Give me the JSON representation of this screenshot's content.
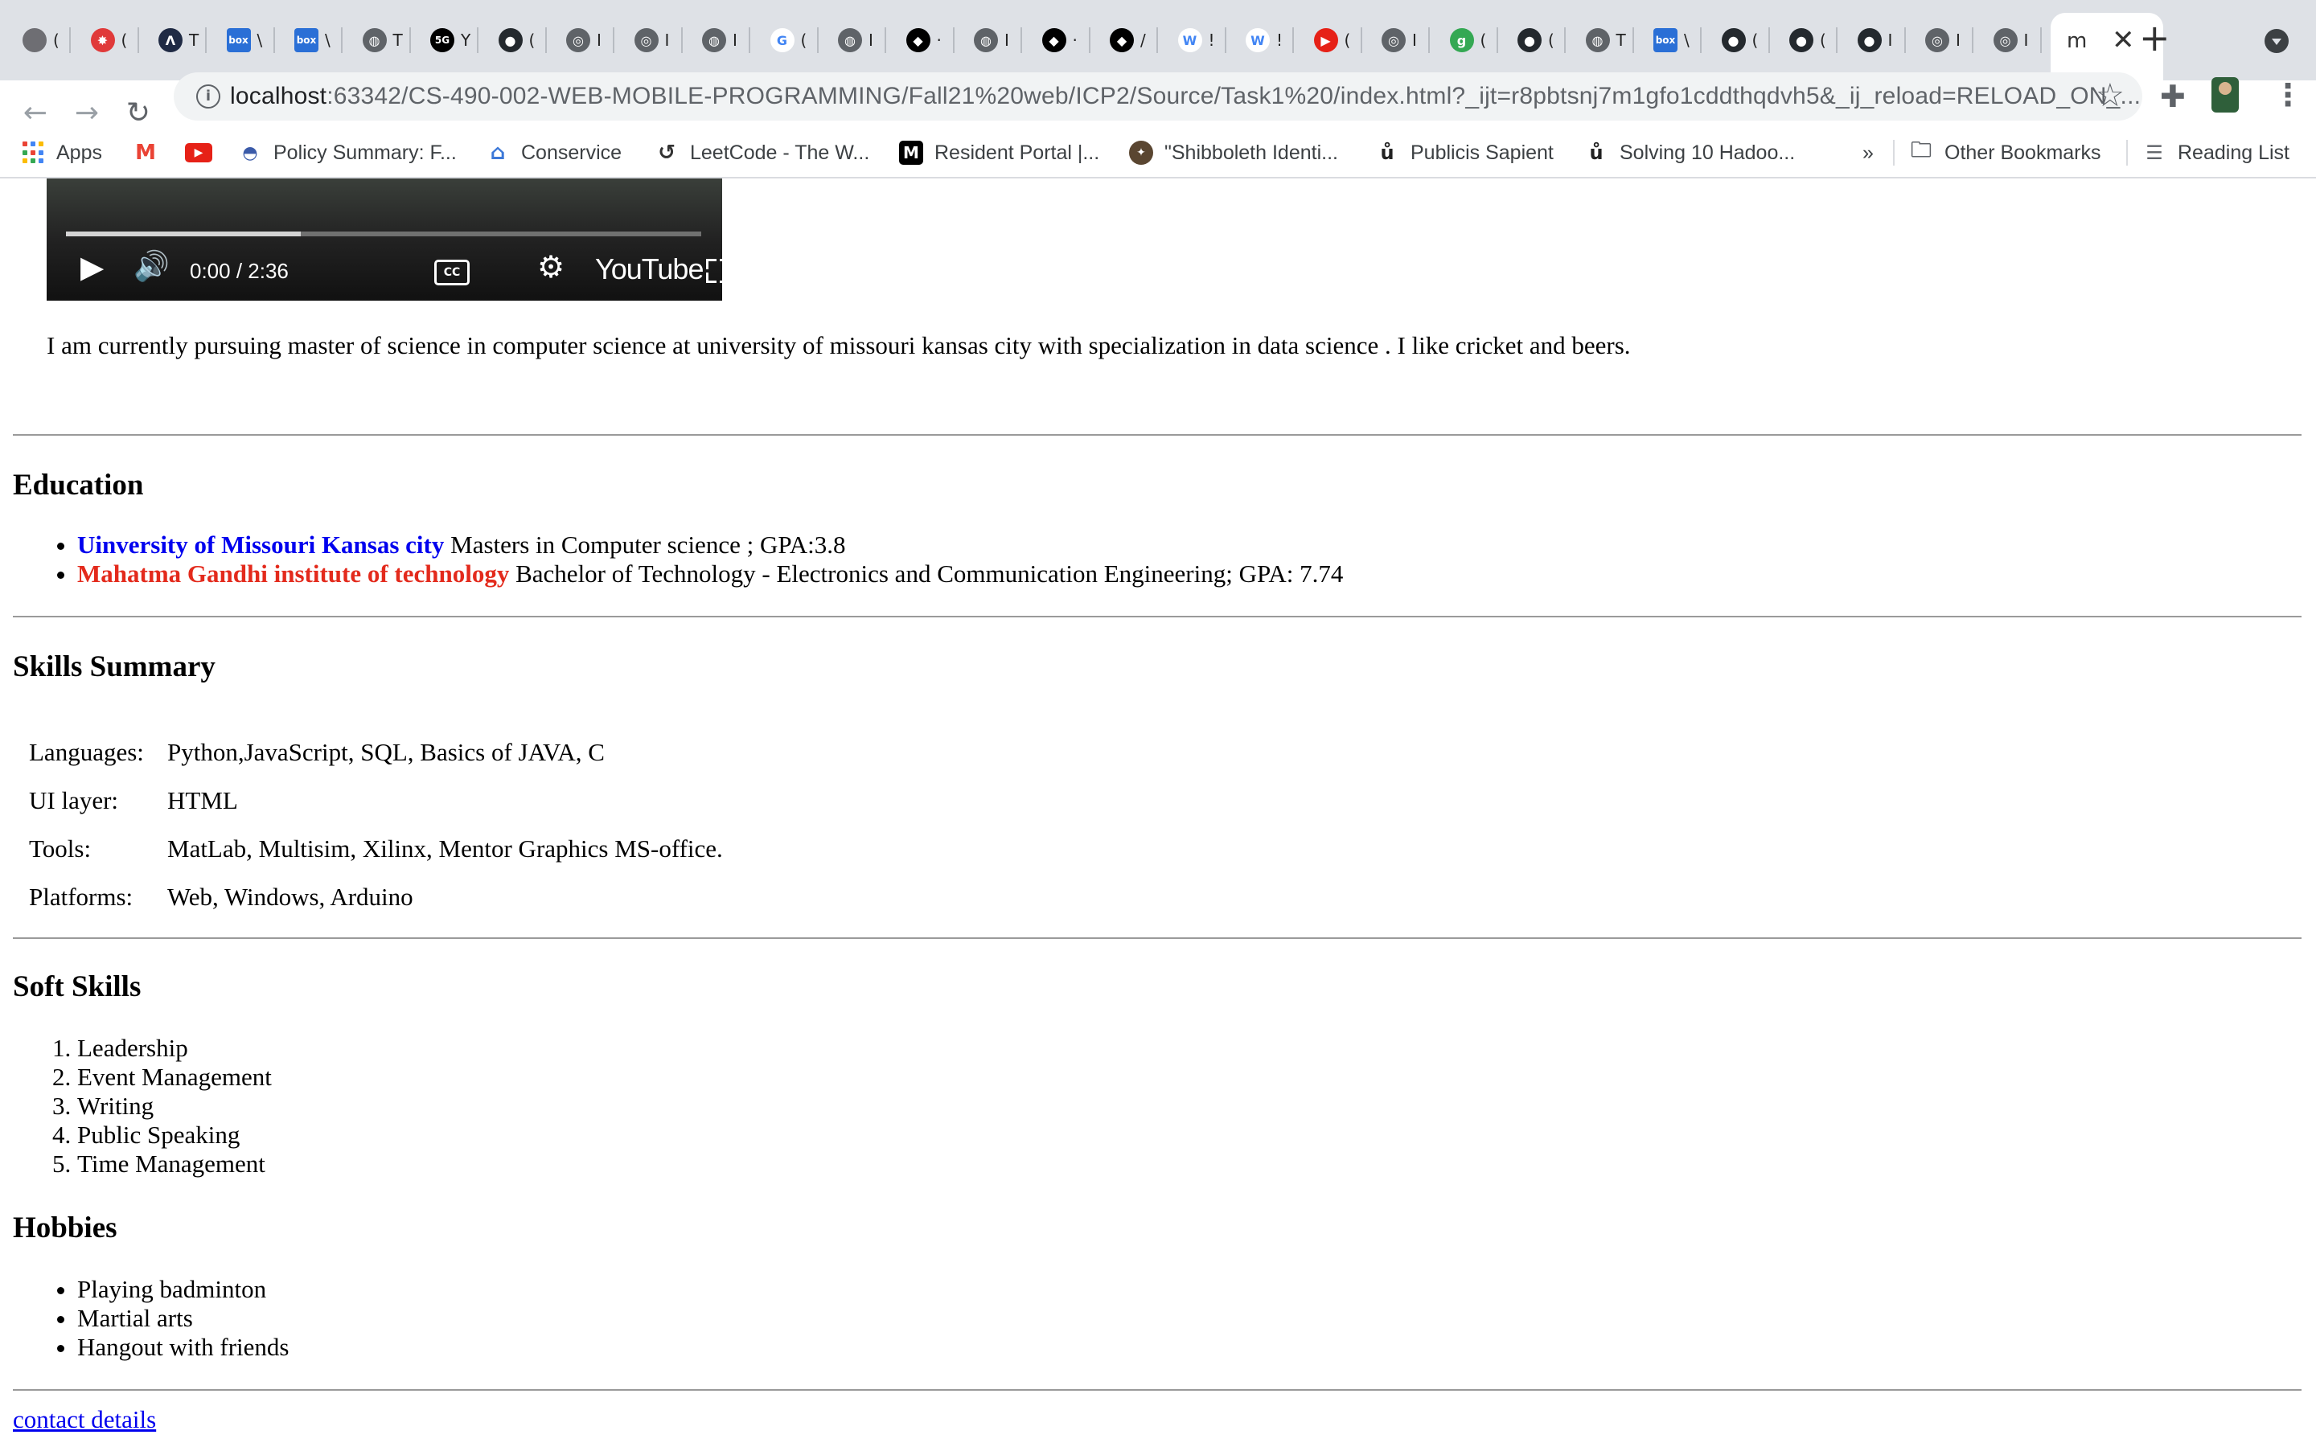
{
  "browser": {
    "tabs": [
      {
        "icon": "apple-icon",
        "color": "#6e6e73",
        "glyph": "",
        "sep": "("
      },
      {
        "icon": "umkc-icon",
        "color": "#e03a3a",
        "glyph": "✸",
        "sep": "("
      },
      {
        "icon": "leetcode-icon",
        "color": "#1f2a44",
        "glyph": "Λ",
        "sep": "T"
      },
      {
        "icon": "box-icon",
        "color": "#2a6fd6",
        "glyph": "box",
        "sep": "\\"
      },
      {
        "icon": "box-icon",
        "color": "#2a6fd6",
        "glyph": "box",
        "sep": "\\"
      },
      {
        "icon": "globe-icon",
        "color": "#5f6368",
        "glyph": "◍",
        "sep": "T"
      },
      {
        "icon": "sg-icon",
        "color": "#000000",
        "glyph": "5G",
        "sep": "Y"
      },
      {
        "icon": "github-icon",
        "color": "#24292e",
        "glyph": "●",
        "sep": "("
      },
      {
        "icon": "chrome-icon",
        "color": "#5f6368",
        "glyph": "◎",
        "sep": "I"
      },
      {
        "icon": "chrome-icon",
        "color": "#5f6368",
        "glyph": "◎",
        "sep": "I"
      },
      {
        "icon": "globe-icon",
        "color": "#5f6368",
        "glyph": "◍",
        "sep": "I"
      },
      {
        "icon": "google-icon",
        "color": "#ffffff",
        "glyph": "G",
        "sep": "("
      },
      {
        "icon": "globe-icon",
        "color": "#5f6368",
        "glyph": "◍",
        "sep": "I"
      },
      {
        "icon": "tag-icon",
        "color": "#000000",
        "glyph": "◆",
        "sep": "·"
      },
      {
        "icon": "globe-icon",
        "color": "#5f6368",
        "glyph": "◍",
        "sep": "I"
      },
      {
        "icon": "tag-icon",
        "color": "#000000",
        "glyph": "◆",
        "sep": "·"
      },
      {
        "icon": "tag-icon",
        "color": "#000000",
        "glyph": "◆",
        "sep": "/"
      },
      {
        "icon": "w3-icon",
        "color": "#ffffff",
        "glyph": "W",
        "sep": "!"
      },
      {
        "icon": "w3-icon",
        "color": "#ffffff",
        "glyph": "W",
        "sep": "!"
      },
      {
        "icon": "youtube-icon",
        "color": "#e62117",
        "glyph": "▶",
        "sep": "("
      },
      {
        "icon": "chrome-icon",
        "color": "#5f6368",
        "glyph": "◎",
        "sep": "I"
      },
      {
        "icon": "green-g-icon",
        "color": "#34a853",
        "glyph": "g",
        "sep": "("
      },
      {
        "icon": "github-icon",
        "color": "#24292e",
        "glyph": "●",
        "sep": "("
      },
      {
        "icon": "globe-icon",
        "color": "#5f6368",
        "glyph": "◍",
        "sep": "T"
      },
      {
        "icon": "box-icon",
        "color": "#2a6fd6",
        "glyph": "box",
        "sep": "\\"
      },
      {
        "icon": "github-icon",
        "color": "#24292e",
        "glyph": "●",
        "sep": "("
      },
      {
        "icon": "github-icon",
        "color": "#24292e",
        "glyph": "●",
        "sep": "("
      },
      {
        "icon": "github-icon",
        "color": "#24292e",
        "glyph": "●",
        "sep": "I"
      },
      {
        "icon": "chrome-icon",
        "color": "#5f6368",
        "glyph": "◎",
        "sep": "I"
      },
      {
        "icon": "chrome-icon",
        "color": "#5f6368",
        "glyph": "◎",
        "sep": "I"
      }
    ],
    "active_tab": {
      "title": "m",
      "close": "✕"
    },
    "new_tab": "+",
    "url": {
      "host": "localhost",
      "path": ":63342/CS-490-002-WEB-MOBILE-PROGRAMMING/Fall21%20web/ICP2/Source/Task1%20/index.html?_ijt=r8pbtsnj7m1gfo1cddthqdvh5&_ij_reload=RELOAD_ON_..."
    },
    "bookmarks": [
      {
        "label": "Apps",
        "icon": "apps-grid-icon"
      },
      {
        "label": "",
        "icon": "gmail-icon"
      },
      {
        "label": "",
        "icon": "youtube-icon"
      },
      {
        "label": "Policy Summary: F...",
        "icon": "policy-icon"
      },
      {
        "label": "Conservice",
        "icon": "home-icon"
      },
      {
        "label": "LeetCode - The W...",
        "icon": "leetcode-icon"
      },
      {
        "label": "Resident Portal |...",
        "icon": "resident-portal-icon"
      },
      {
        "label": "\"Shibboleth Identi...",
        "icon": "shibboleth-icon"
      },
      {
        "label": "Publicis Sapient",
        "icon": "sapient-icon"
      },
      {
        "label": "Solving 10 Hadoo...",
        "icon": "sapient-icon"
      }
    ],
    "bookmarks_overflow": "»",
    "other_bookmarks": "Other Bookmarks",
    "reading_list": "Reading List"
  },
  "video": {
    "time": "0:00 / 2:36",
    "progress_buffered": 0.37,
    "cc_label": "CC",
    "brand": "YouTube"
  },
  "about": "I am currently pursuing master of science in computer science at university of missouri kansas city with specialization in data science . I like cricket and beers.",
  "education": {
    "heading": "Education",
    "items": [
      {
        "school": "Uinversity of Missouri Kansas city",
        "detail": " Masters in Computer science ; GPA:3.8",
        "color": "#0000ee"
      },
      {
        "school": "Mahatma Gandhi institute of technology",
        "detail": " Bachelor of Technology - Electronics and Communication Engineering; GPA: 7.74",
        "color": "#e32a1c"
      }
    ]
  },
  "skills": {
    "heading": "Skills Summary",
    "rows": [
      {
        "key": "Languages:",
        "value": "Python,JavaScript, SQL, Basics of JAVA, C"
      },
      {
        "key": "UI layer:",
        "value": "HTML"
      },
      {
        "key": "Tools:",
        "value": "MatLab, Multisim, Xilinx, Mentor Graphics MS-office."
      },
      {
        "key": "Platforms:",
        "value": "Web, Windows, Arduino"
      }
    ]
  },
  "soft_skills": {
    "heading": "Soft Skills",
    "items": [
      "Leadership",
      "Event Management",
      "Writing",
      "Public Speaking",
      "Time Management"
    ]
  },
  "hobbies": {
    "heading": "Hobbies",
    "items": [
      "Playing badminton",
      "Martial arts",
      "Hangout with friends"
    ]
  },
  "contact_link": "contact details"
}
